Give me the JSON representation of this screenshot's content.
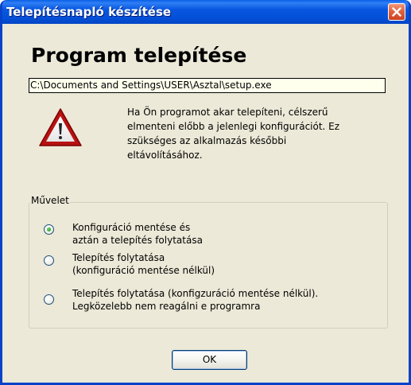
{
  "window": {
    "title": "Telepítésnapló készítése",
    "close_icon": "close-icon",
    "colors": {
      "titlebar": "#0a5fe6",
      "body": "#ece9d8",
      "close": "#e2623c"
    }
  },
  "heading": "Program telepítése",
  "path_value": "C:\\Documents and Settings\\USER\\Asztal\\setup.exe",
  "info": {
    "icon": "warning-icon",
    "text": "Ha Ön programot akar telepíteni, célszerű\nelmenteni előbb a jelenlegi konfigurációt. Ez\nszükséges az alkalmazás későbbi\neltávolításához."
  },
  "action_group": {
    "legend": "Művelet",
    "options": [
      {
        "label": "Konfiguráció mentése és\naztán a telepítés folytatása",
        "selected": true
      },
      {
        "label": "Telepítés folytatása\n(konfiguráció mentése nélkül)",
        "selected": false
      },
      {
        "label": "Telepítés folytatása (konfigzuráció mentése nélkül).\nLegközelebb nem reagálni e programra",
        "selected": false
      }
    ]
  },
  "ok_label": "OK"
}
